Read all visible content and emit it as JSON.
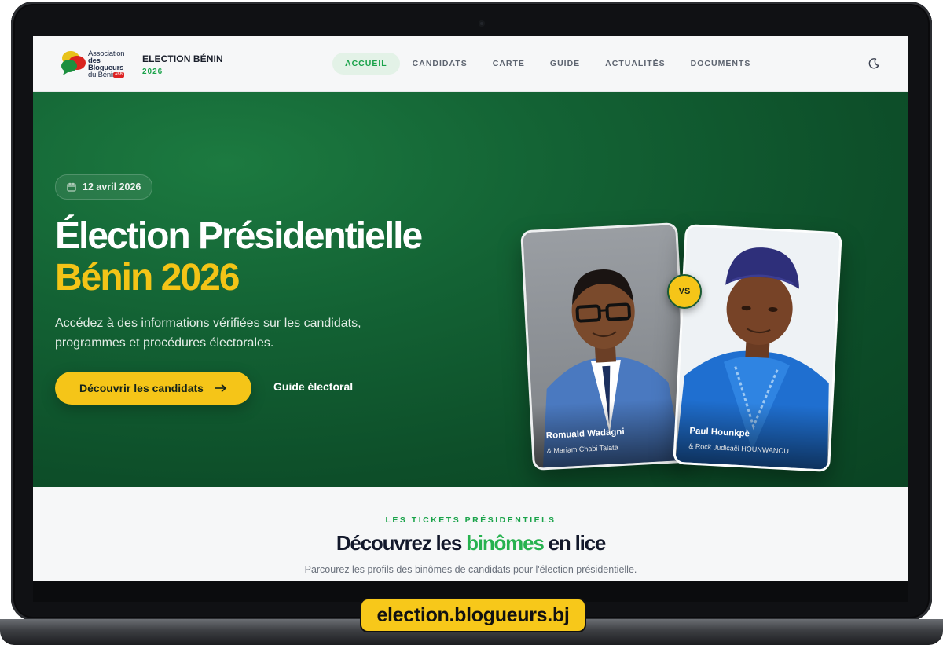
{
  "header": {
    "logo_lines": [
      "Association",
      "des Blogueurs",
      "du Bénin"
    ],
    "logo_tag": "ABB",
    "site_title": "ELECTION BÉNIN",
    "site_year": "2026",
    "nav": [
      {
        "label": "ACCUEIL",
        "active": true
      },
      {
        "label": "CANDIDATS",
        "active": false
      },
      {
        "label": "CARTE",
        "active": false
      },
      {
        "label": "GUIDE",
        "active": false
      },
      {
        "label": "ACTUALITÉS",
        "active": false
      },
      {
        "label": "DOCUMENTS",
        "active": false
      }
    ],
    "theme_icon": "moon-icon"
  },
  "hero": {
    "date": "12 avril 2026",
    "title_line1": "Élection Présidentielle",
    "title_line2": "Bénin 2026",
    "description": "Accédez à des informations vérifiées sur les candidats, programmes et procédures électorales.",
    "primary_button": "Découvrir les candidats",
    "secondary_link": "Guide électoral",
    "vs_label": "VS",
    "candidates": [
      {
        "name": "Romuald Wadagni",
        "running_mate": "& Mariam Chabi Talata"
      },
      {
        "name": "Paul Hounkpè",
        "running_mate": "& Rock Judicaël HOUNWANOU"
      }
    ]
  },
  "tickets": {
    "eyebrow": "LES TICKETS PRÉSIDENTIELS",
    "title_part1": "Découvrez les ",
    "title_highlight": "binômes",
    "title_part2": " en lice",
    "subtitle": "Parcourez les profils des binômes de candidats pour l'élection présidentielle."
  },
  "url_badge": "election.blogueurs.bj",
  "colors": {
    "accent_green": "#1aa34a",
    "hero_green": "#136234",
    "accent_yellow": "#f5c518"
  }
}
